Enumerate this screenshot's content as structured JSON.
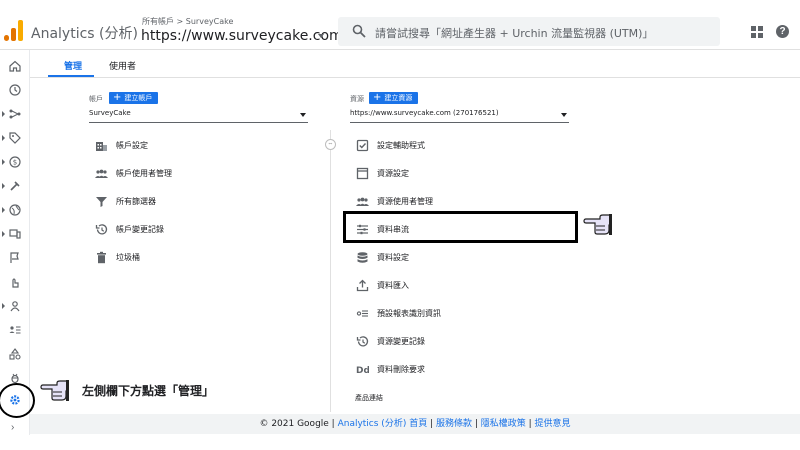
{
  "header": {
    "app_title": "Analytics (分析)",
    "breadcrumb": "所有帳戶 > SurveyCake",
    "property_url": "https://www.surveycake.com",
    "search_placeholder": "請嘗試搜尋「網址產生器 + Urchin 流量監視器 (UTM)」",
    "logo_colors": [
      "#f9ab00",
      "#e37400",
      "#e37400"
    ]
  },
  "tabs": [
    {
      "label": "管理",
      "active": true
    },
    {
      "label": "使用者",
      "active": false
    }
  ],
  "account_column": {
    "label": "帳戶",
    "create_button": "建立帳戶",
    "selected": "SurveyCake",
    "items": [
      {
        "label": "帳戶設定",
        "icon": "building-icon"
      },
      {
        "label": "帳戶使用者管理",
        "icon": "people-icon"
      },
      {
        "label": "所有篩選器",
        "icon": "filter-icon"
      },
      {
        "label": "帳戶變更記錄",
        "icon": "history-icon"
      },
      {
        "label": "垃圾桶",
        "icon": "trash-icon"
      }
    ]
  },
  "property_column": {
    "label": "資源",
    "create_button": "建立資源",
    "selected": "https://www.surveycake.com (270176521)",
    "items": [
      {
        "label": "設定輔助程式",
        "icon": "checkbox-icon"
      },
      {
        "label": "資源設定",
        "icon": "square-icon"
      },
      {
        "label": "資源使用者管理",
        "icon": "people-icon"
      },
      {
        "label": "資料串流",
        "icon": "data-stream-icon"
      },
      {
        "label": "資料設定",
        "icon": "database-icon"
      },
      {
        "label": "資料匯入",
        "icon": "upload-icon"
      },
      {
        "label": "預設報表識別資訊",
        "icon": "identity-icon"
      },
      {
        "label": "資源變更記錄",
        "icon": "history-icon"
      },
      {
        "label": "資料刪除要求",
        "icon": "dd-icon"
      }
    ],
    "section_label": "產品連結"
  },
  "annotation": {
    "callout": "左側欄下方點選「管理」"
  },
  "footer": {
    "prefix": "© 2021 Google | ",
    "links": [
      "Analytics (分析) 首頁",
      "服務條款",
      "隱私權政策",
      "提供意見"
    ],
    "separator": " | "
  },
  "colors": {
    "accent": "#1a73e8",
    "highlight_border": "#000000",
    "hand_fill": "#e6e3f7"
  }
}
